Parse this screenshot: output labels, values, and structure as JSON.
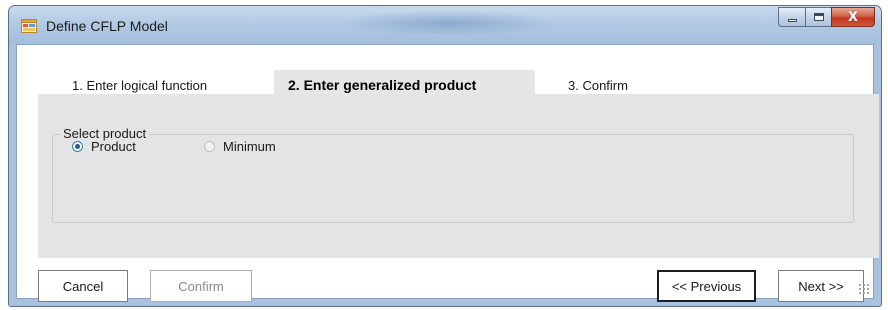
{
  "window": {
    "title": "Define CFLP Model",
    "icons": {
      "app": "window-form-icon",
      "minimize": "minimize-icon",
      "maximize": "maximize-icon",
      "close": "close-icon"
    },
    "close_glyph": "X"
  },
  "tabs": [
    {
      "label": "1. Enter logical function",
      "active": false
    },
    {
      "label": "2. Enter generalized product",
      "active": true
    },
    {
      "label": "3. Confirm",
      "active": false
    }
  ],
  "group": {
    "label": "Select product",
    "options": [
      {
        "label": "Product",
        "selected": true,
        "enabled": true
      },
      {
        "label": "Minimum",
        "selected": false,
        "enabled": false
      }
    ]
  },
  "buttons": {
    "cancel": "Cancel",
    "confirm": "Confirm",
    "previous": "<< Previous",
    "next": "Next >>"
  },
  "colors": {
    "titlebar": "#b3cae4",
    "panel": "#e4e4e4",
    "close_button": "#c2371d"
  }
}
